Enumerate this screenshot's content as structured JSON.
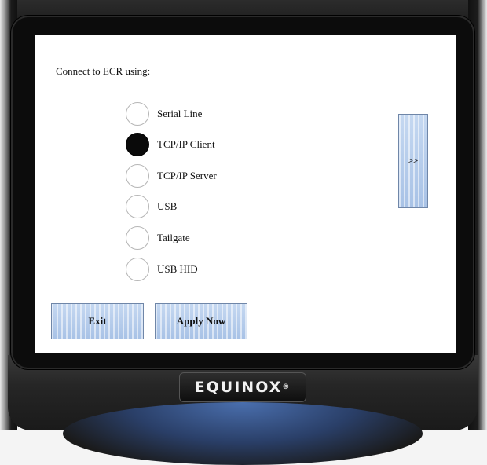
{
  "screen": {
    "prompt": "Connect to ECR using:",
    "options": [
      {
        "label": "Serial Line",
        "selected": false
      },
      {
        "label": "TCP/IP Client",
        "selected": true
      },
      {
        "label": "TCP/IP Server",
        "selected": false
      },
      {
        "label": "USB",
        "selected": false
      },
      {
        "label": "Tailgate",
        "selected": false
      },
      {
        "label": "USB HID",
        "selected": false
      }
    ],
    "next_label": ">>",
    "exit_label": "Exit",
    "apply_label": "Apply Now"
  },
  "device": {
    "brand": "EQUINOX"
  },
  "colors": {
    "button_fill": "#b6cceb",
    "button_border": "#6f86a8",
    "selected_radio": "#0a0a0a"
  }
}
